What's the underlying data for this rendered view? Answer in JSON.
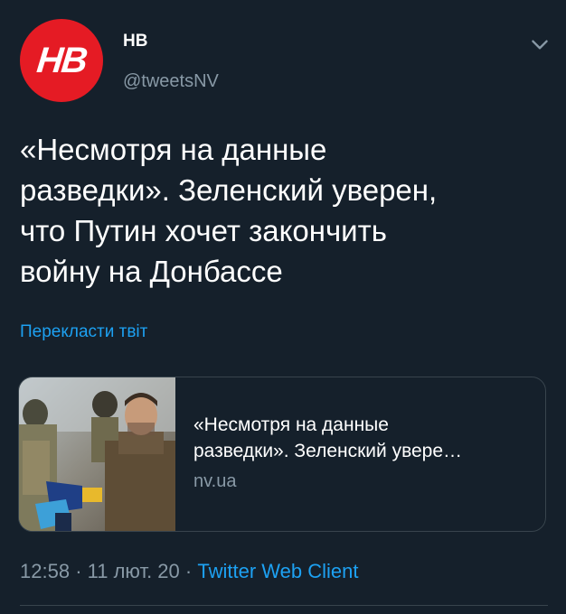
{
  "account": {
    "avatar_text": "НВ",
    "display_name": "НВ",
    "handle": "@tweetsNV"
  },
  "tweet": {
    "text": "«Несмотря на данные\nразведки». Зеленский уверен,\nчто Путин хочет закончить\nвойну на Донбассе",
    "translate_label": "Перекласти твіт",
    "time": "12:58",
    "date": "11 лют. 20",
    "source": "Twitter Web Client",
    "separator": "·"
  },
  "card": {
    "title_line1": "«Несмотря на данные",
    "title_line2": "разведки». Зеленский увере…",
    "domain": "nv.ua"
  },
  "colors": {
    "background": "#15202b",
    "accent": "#1da1f2",
    "secondary_text": "#8899a6",
    "avatar": "#e51b24"
  },
  "icons": {
    "menu": "chevron-down-icon"
  }
}
